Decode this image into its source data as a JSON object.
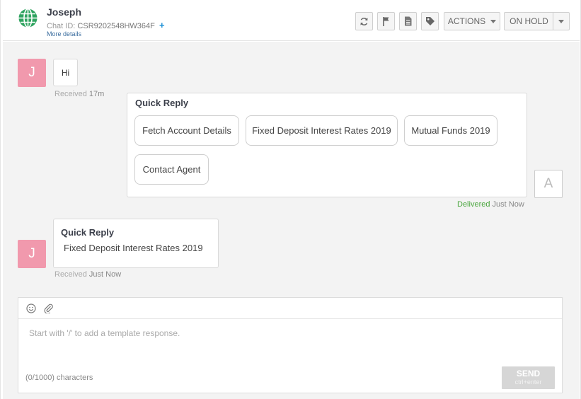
{
  "header": {
    "contact_name": "Joseph",
    "chat_id_label": "Chat ID:",
    "chat_id_value": "CSR9202548HW364F",
    "add_symbol": "+",
    "more_details": "More details",
    "actions_label": "ACTIONS",
    "status_label": "ON HOLD",
    "icons": [
      "refresh-icon",
      "flag-icon",
      "document-icon",
      "tag-icon"
    ]
  },
  "messages": [
    {
      "sender": "customer",
      "avatar_letter": "J",
      "text": "Hi",
      "status": "Received",
      "time": "17m"
    },
    {
      "sender": "agent",
      "avatar_letter": "A",
      "title": "Quick Reply",
      "options": [
        "Fetch Account Details",
        "Fixed Deposit Interest Rates 2019",
        "Mutual Funds 2019",
        "Contact Agent"
      ],
      "status": "Delivered",
      "time": "Just Now"
    },
    {
      "sender": "customer",
      "avatar_letter": "J",
      "title": "Quick Reply",
      "text": "Fixed Deposit Interest Rates 2019",
      "status": "Received",
      "time": "Just Now"
    }
  ],
  "composer": {
    "placeholder": "Start with '/' to add a template response.",
    "counter": "(0/1000) characters",
    "send_label": "SEND",
    "send_hint": "ctrl+enter",
    "icons": [
      "emoji-icon",
      "attachment-icon"
    ]
  },
  "colors": {
    "customer_avatar": "#f199ad",
    "delivered": "#4aa63e",
    "link": "#1e90d6",
    "chat_bg": "#f3f3f3"
  }
}
